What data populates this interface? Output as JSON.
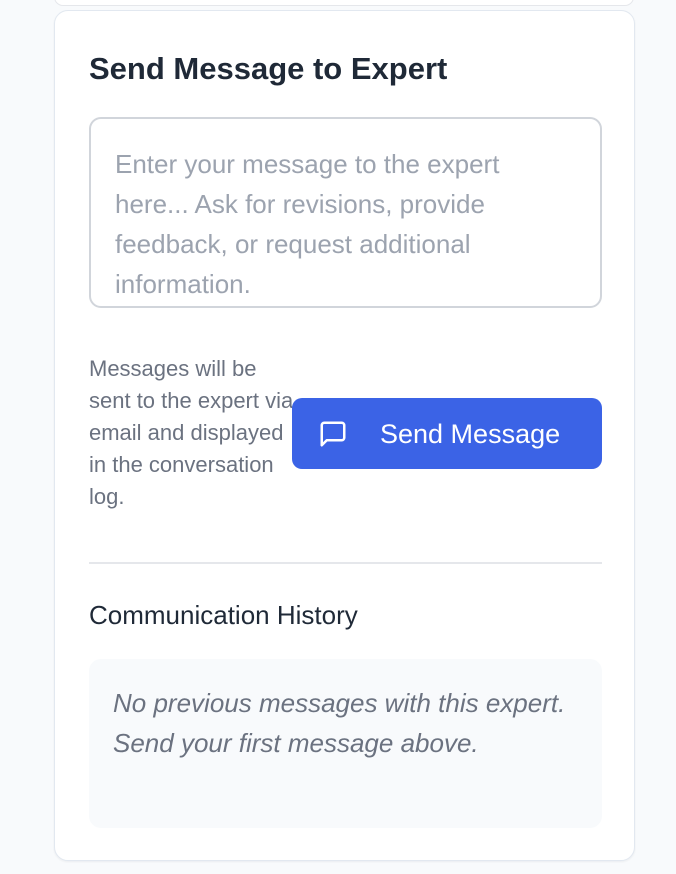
{
  "composer": {
    "title": "Send Message to Expert",
    "placeholder": "Enter your message to the expert here... Ask for revisions, provide feedback, or request additional information.",
    "hint": "Messages will be sent to the expert via email and displayed in the conversation log.",
    "send_label": "Send Message",
    "send_icon": "message-square-icon"
  },
  "history": {
    "title": "Communication History",
    "empty_text": "No previous messages with this expert. Send your first message above."
  },
  "colors": {
    "primary": "#3b63e6",
    "text": "#1f2937",
    "muted": "#6b7280",
    "placeholder": "#9ca3af"
  }
}
